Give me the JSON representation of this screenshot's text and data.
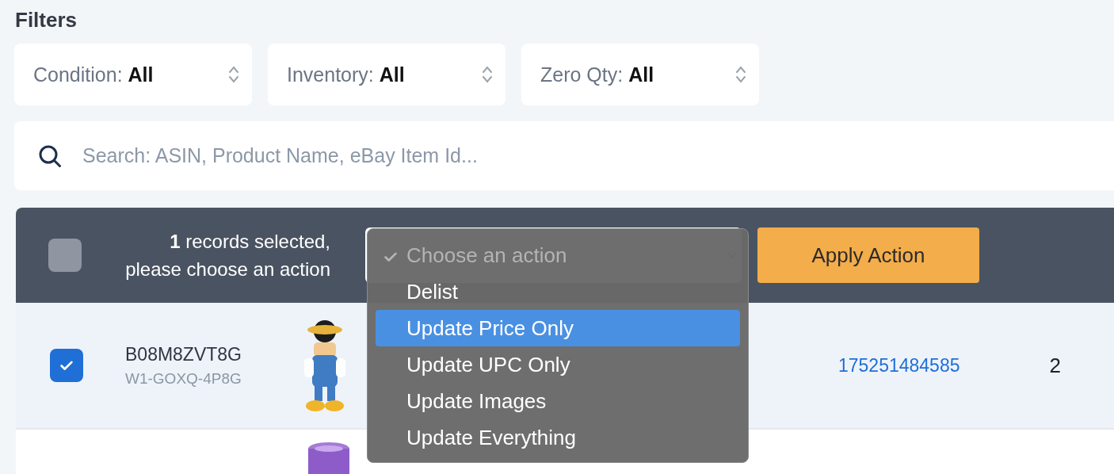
{
  "title": "Filters",
  "filters": [
    {
      "label": "Condition:",
      "value": "All"
    },
    {
      "label": "Inventory:",
      "value": "All"
    },
    {
      "label": "Zero Qty:",
      "value": "All"
    }
  ],
  "search": {
    "placeholder": "Search: ASIN, Product Name, eBay Item Id..."
  },
  "bulk_bar": {
    "checked": false,
    "message": "**1** records selected, please choose an action",
    "apply_button": "Apply Action"
  },
  "action_menu": [
    {
      "label": "Choose an action",
      "selected": true,
      "disabled": true,
      "highlighted": false
    },
    {
      "label": "Delist",
      "selected": false,
      "disabled": false,
      "highlighted": false
    },
    {
      "label": "Update Price Only",
      "selected": false,
      "disabled": false,
      "highlighted": true
    },
    {
      "label": "Update UPC Only",
      "selected": false,
      "disabled": false,
      "highlighted": false
    },
    {
      "label": "Update Images",
      "selected": false,
      "disabled": false,
      "highlighted": false
    },
    {
      "label": "Update Everything",
      "selected": false,
      "disabled": false,
      "highlighted": false
    }
  ],
  "rows": [
    {
      "kind": "full",
      "checked": true,
      "asin": "B08M8ZVT8G",
      "sku": "W1-GOXQ-4P8G",
      "image": {
        "kind": "figure"
      },
      "ebay_item_id": "175251484585",
      "column_5": "2"
    },
    {
      "kind": "partial",
      "image": {
        "kind": "cup"
      }
    }
  ]
}
